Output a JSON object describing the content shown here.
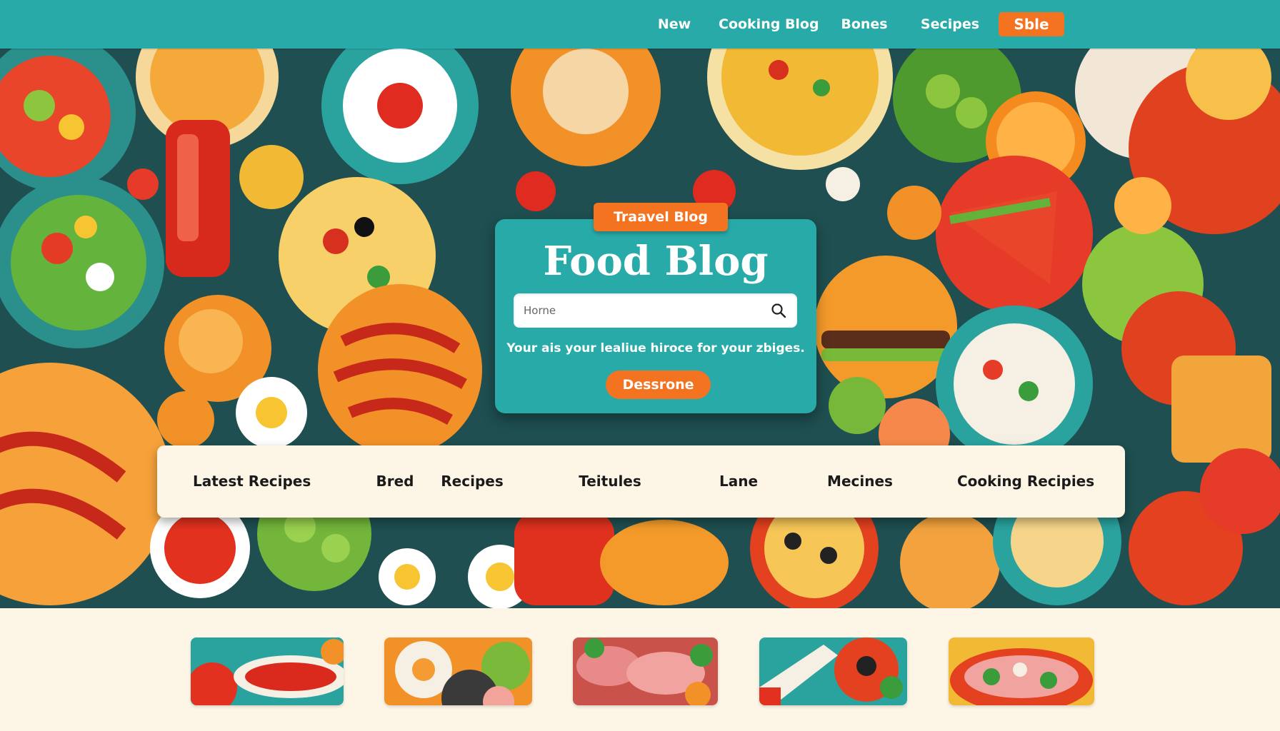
{
  "nav": {
    "items": [
      "New",
      "Cooking Blog",
      "Bones",
      "Secipes"
    ],
    "cta_label": "Sble"
  },
  "hero": {
    "tag_label": "Traavel Blog",
    "title": "Food Blog",
    "search_placeholder": "Horne",
    "subtitle": "Your ais your lealiue hiroce for your zbiges.",
    "button_label": "Dessrone"
  },
  "categories": [
    "Latest Recipes",
    "Bred",
    "Recipes",
    "Teitules",
    "Lane",
    "Mecines",
    "Cooking Recipies"
  ],
  "thumbnails": [
    {
      "icon": "tomato-sauce-thumbnail"
    },
    {
      "icon": "egg-salad-thumbnail"
    },
    {
      "icon": "meat-platter-thumbnail"
    },
    {
      "icon": "knife-dish-thumbnail"
    },
    {
      "icon": "pasta-bowl-thumbnail"
    }
  ],
  "colors": {
    "teal": "#27aaa8",
    "orange": "#f47320",
    "cream": "#fdf6e6",
    "dark_text": "#1a1a1a"
  },
  "icons": [
    "search-icon"
  ]
}
